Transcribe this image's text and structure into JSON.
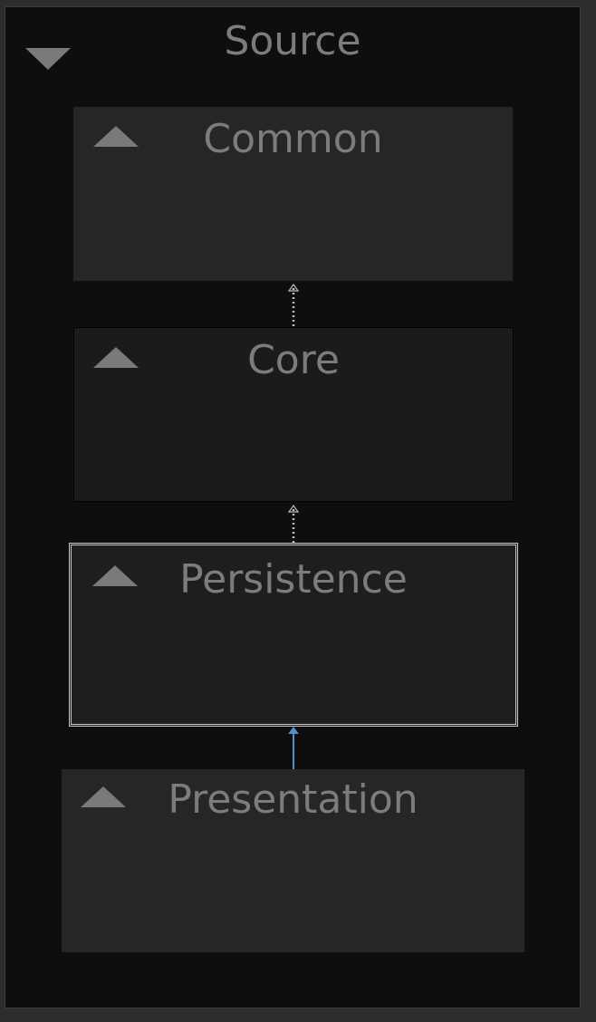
{
  "group": {
    "title": "Source",
    "toggle_icon": "chevron-down-icon"
  },
  "nodes": [
    {
      "id": "common",
      "label": "Common",
      "toggle_icon": "chevron-up-icon"
    },
    {
      "id": "core",
      "label": "Core",
      "toggle_icon": "chevron-up-icon"
    },
    {
      "id": "persistence",
      "label": "Persistence",
      "toggle_icon": "chevron-up-icon",
      "selected": true
    },
    {
      "id": "presentation",
      "label": "Presentation",
      "toggle_icon": "chevron-up-icon"
    }
  ],
  "links": [
    {
      "from": "Core",
      "to": "Common",
      "style": "dotted",
      "color": "#bdbdbd"
    },
    {
      "from": "Persistence",
      "to": "Core",
      "style": "dotted",
      "color": "#bdbdbd"
    },
    {
      "from": "Presentation",
      "to": "Persistence",
      "style": "solid",
      "color": "#4f8fd0"
    }
  ],
  "colors": {
    "background": "#0e0e0e",
    "node_fill": "#262626",
    "node_fill_dark": "#1b1b1b",
    "text": "#7c7c7c",
    "selection_border": "#c8c8c8",
    "highlight_link": "#4f8fd0"
  }
}
